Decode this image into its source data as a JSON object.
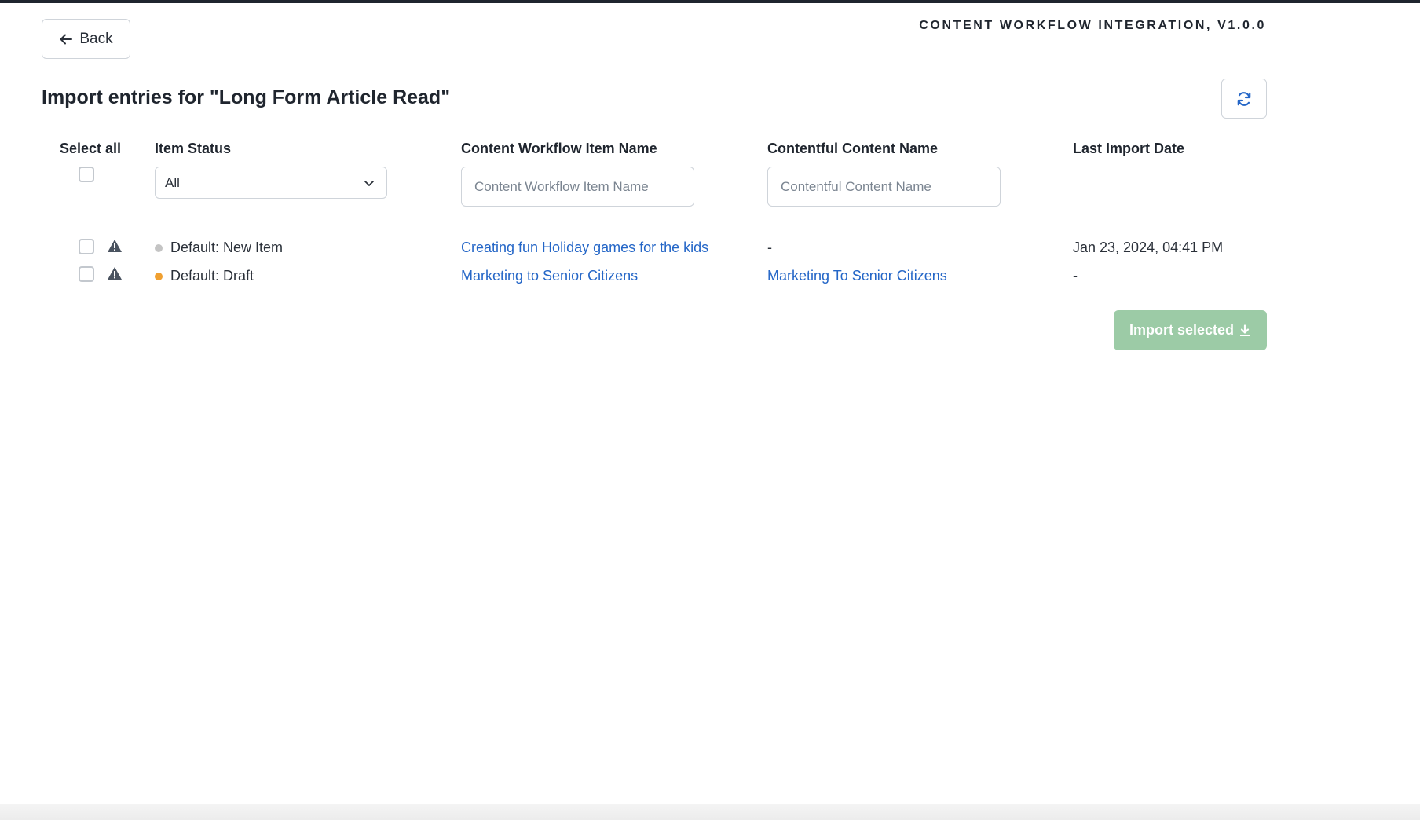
{
  "header": {
    "back_label": "Back",
    "app_version": "CONTENT WORKFLOW INTEGRATION, V1.0.0",
    "page_title": "Import entries for \"Long Form Article Read\""
  },
  "columns": {
    "select_all": "Select all",
    "item_status": "Item Status",
    "workflow_item_name": "Content Workflow Item Name",
    "contentful_content_name": "Contentful Content Name",
    "last_import_date": "Last Import Date"
  },
  "filters": {
    "status_selected": "All",
    "workflow_item_placeholder": "Content Workflow Item Name",
    "contentful_name_placeholder": "Contentful Content Name"
  },
  "rows": [
    {
      "status": "Default: New Item",
      "status_color": "#c4c4c4",
      "workflow_item_name": "Creating fun Holiday games for the kids",
      "contentful_content_name": "-",
      "last_import_date": "Jan 23, 2024, 04:41 PM"
    },
    {
      "status": "Default: Draft",
      "status_color": "#f0a030",
      "workflow_item_name": "Marketing to Senior Citizens",
      "contentful_content_name": "Marketing To Senior Citizens",
      "last_import_date": "-"
    }
  ],
  "actions": {
    "import_selected_label": "Import selected"
  },
  "colors": {
    "link": "#2466c7",
    "import_button": "#9ccba6",
    "refresh_icon": "#2466c7"
  }
}
